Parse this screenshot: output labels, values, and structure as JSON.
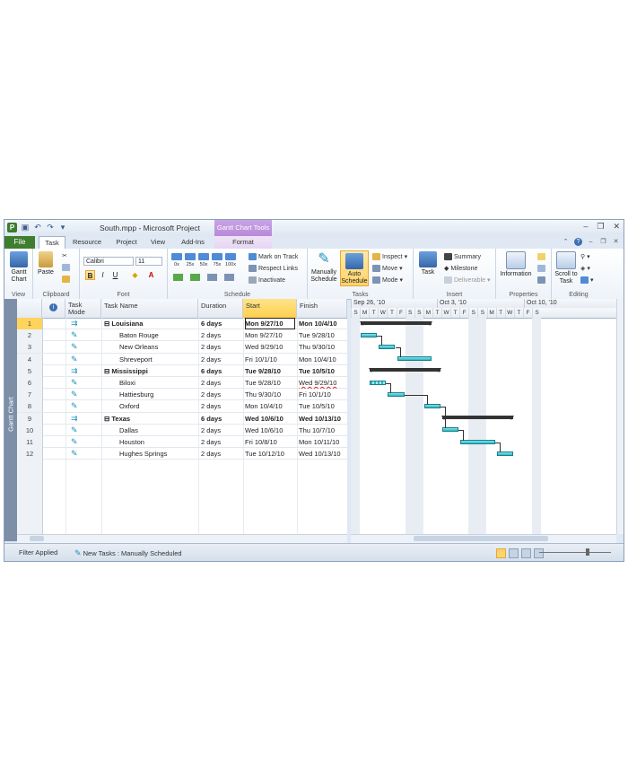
{
  "window": {
    "app_icon": "P",
    "title": "South.mpp  -  Microsoft Project",
    "context_tab_header": "Gantt Chart Tools"
  },
  "tabs": {
    "file": "File",
    "task": "Task",
    "resource": "Resource",
    "project": "Project",
    "view": "View",
    "addins": "Add-Ins",
    "format": "Format"
  },
  "ribbon": {
    "view_group": {
      "gantt_chart": "Gantt Chart",
      "label": "View"
    },
    "clipboard_group": {
      "paste": "Paste",
      "label": "Clipboard"
    },
    "font_group": {
      "font_name": "Calibri",
      "font_size": "11",
      "bold": "B",
      "italic": "I",
      "underline": "U",
      "label": "Font"
    },
    "schedule_group": {
      "percent_buttons": [
        "0x",
        "25x",
        "50x",
        "75x",
        "100x"
      ],
      "mark_on_track": "Mark on Track",
      "respect_links": "Respect Links",
      "inactivate": "Inactivate",
      "label": "Schedule"
    },
    "tasks_group": {
      "manually_schedule": "Manually Schedule",
      "auto_schedule": "Auto Schedule",
      "inspect": "Inspect",
      "move": "Move",
      "mode": "Mode",
      "label": "Tasks"
    },
    "insert_group": {
      "task": "Task",
      "summary": "Summary",
      "milestone": "Milestone",
      "deliverable": "Deliverable",
      "label": "Insert"
    },
    "properties_group": {
      "information": "Information",
      "label": "Properties"
    },
    "editing_group": {
      "scroll_to_task": "Scroll to Task",
      "label": "Editing"
    }
  },
  "view_bar_label": "Gantt Chart",
  "table": {
    "columns": [
      "Task Mode",
      "Task Name",
      "Duration",
      "Start",
      "Finish"
    ],
    "rows": [
      {
        "id": "1",
        "name": "Louisiana",
        "duration": "6 days",
        "start": "Mon 9/27/10",
        "finish": "Mon 10/4/10",
        "summary": true,
        "mode": "auto"
      },
      {
        "id": "2",
        "name": "Baton Rouge",
        "duration": "2 days",
        "start": "Mon 9/27/10",
        "finish": "Tue 9/28/10",
        "summary": false,
        "mode": "manual"
      },
      {
        "id": "3",
        "name": "New Orleans",
        "duration": "2 days",
        "start": "Wed 9/29/10",
        "finish": "Thu 9/30/10",
        "summary": false,
        "mode": "manual"
      },
      {
        "id": "4",
        "name": "Shreveport",
        "duration": "2 days",
        "start": "Fri 10/1/10",
        "finish": "Mon 10/4/10",
        "summary": false,
        "mode": "manual"
      },
      {
        "id": "5",
        "name": "Mississippi",
        "duration": "6 days",
        "start": "Tue 9/28/10",
        "finish": "Tue 10/5/10",
        "summary": true,
        "mode": "auto"
      },
      {
        "id": "6",
        "name": "Biloxi",
        "duration": "2 days",
        "start": "Tue 9/28/10",
        "finish": "Wed 9/29/10",
        "summary": false,
        "mode": "manual"
      },
      {
        "id": "7",
        "name": "Hattiesburg",
        "duration": "2 days",
        "start": "Thu 9/30/10",
        "finish": "Fri 10/1/10",
        "summary": false,
        "mode": "manual"
      },
      {
        "id": "8",
        "name": "Oxford",
        "duration": "2 days",
        "start": "Mon 10/4/10",
        "finish": "Tue 10/5/10",
        "summary": false,
        "mode": "manual"
      },
      {
        "id": "9",
        "name": "Texas",
        "duration": "6 days",
        "start": "Wed 10/6/10",
        "finish": "Wed 10/13/10",
        "summary": true,
        "mode": "auto"
      },
      {
        "id": "10",
        "name": "Dallas",
        "duration": "2 days",
        "start": "Wed 10/6/10",
        "finish": "Thu 10/7/10",
        "summary": false,
        "mode": "manual"
      },
      {
        "id": "11",
        "name": "Houston",
        "duration": "2 days",
        "start": "Fri 10/8/10",
        "finish": "Mon 10/11/10",
        "summary": false,
        "mode": "manual"
      },
      {
        "id": "12",
        "name": "Hughes Springs",
        "duration": "2 days",
        "start": "Tue 10/12/10",
        "finish": "Wed 10/13/10",
        "summary": false,
        "mode": "manual"
      }
    ]
  },
  "gantt": {
    "weeks": [
      "Sep 26, '10",
      "Oct 3, '10",
      "Oct 10, '10"
    ],
    "days": [
      "S",
      "M",
      "T",
      "W",
      "T",
      "F",
      "S",
      "S",
      "M",
      "T",
      "W",
      "T",
      "F",
      "S",
      "S",
      "M",
      "T",
      "W",
      "T",
      "F",
      "S"
    ]
  },
  "status_bar": {
    "filter": "Filter Applied",
    "new_tasks": "New Tasks : Manually Scheduled"
  },
  "colors": {
    "file_tab": "#3f7d2f",
    "context_tab": "#b88ad8",
    "selection": "#ffd35c",
    "task_bar": "#2fb6c2",
    "summary_bar": "#333333"
  }
}
